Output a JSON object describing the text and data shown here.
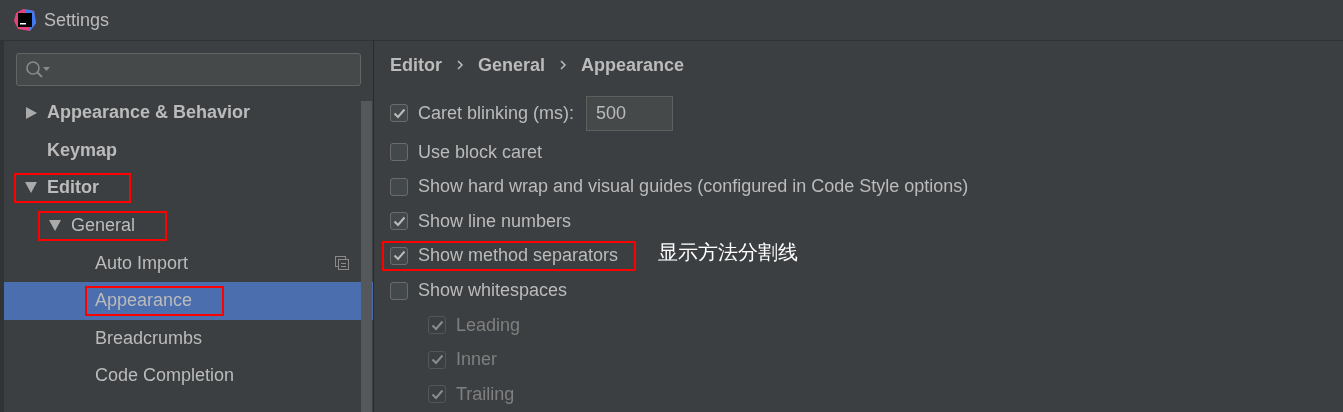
{
  "window": {
    "title": "Settings"
  },
  "tree": [
    {
      "label": "Appearance & Behavior",
      "expanded": false,
      "selected": false,
      "annotated": false
    },
    {
      "label": "Keymap",
      "selected": false,
      "annotated": false
    },
    {
      "label": "Editor",
      "expanded": true,
      "selected": false,
      "annotated": true,
      "children": [
        {
          "label": "General",
          "expanded": true,
          "selected": false,
          "annotated": true,
          "children": [
            {
              "label": "Auto Import",
              "selected": false,
              "annotated": false,
              "scope_icon": true
            },
            {
              "label": "Appearance",
              "selected": true,
              "annotated": true
            },
            {
              "label": "Breadcrumbs",
              "selected": false,
              "annotated": false
            },
            {
              "label": "Code Completion",
              "selected": false,
              "annotated": false
            }
          ]
        }
      ]
    }
  ],
  "breadcrumbs": [
    "Editor",
    "General",
    "Appearance"
  ],
  "options": [
    {
      "label": "Caret blinking (ms):",
      "checked": true,
      "disabled": false,
      "annotated": false,
      "value": "500"
    },
    {
      "label": "Use block caret",
      "checked": false,
      "disabled": false,
      "annotated": false
    },
    {
      "label": "Show hard wrap and visual guides (configured in Code Style options)",
      "checked": false,
      "disabled": false,
      "annotated": false
    },
    {
      "label": "Show line numbers",
      "checked": true,
      "disabled": false,
      "annotated": false
    },
    {
      "label": "Show method separators",
      "checked": true,
      "disabled": false,
      "annotated": true,
      "note": "显示方法分割线"
    },
    {
      "label": "Show whitespaces",
      "checked": false,
      "disabled": false,
      "annotated": false,
      "children": [
        {
          "label": "Leading",
          "checked": true,
          "disabled": true,
          "annotated": false
        },
        {
          "label": "Inner",
          "checked": true,
          "disabled": true,
          "annotated": false
        },
        {
          "label": "Trailing",
          "checked": true,
          "disabled": true,
          "annotated": false
        }
      ]
    }
  ]
}
